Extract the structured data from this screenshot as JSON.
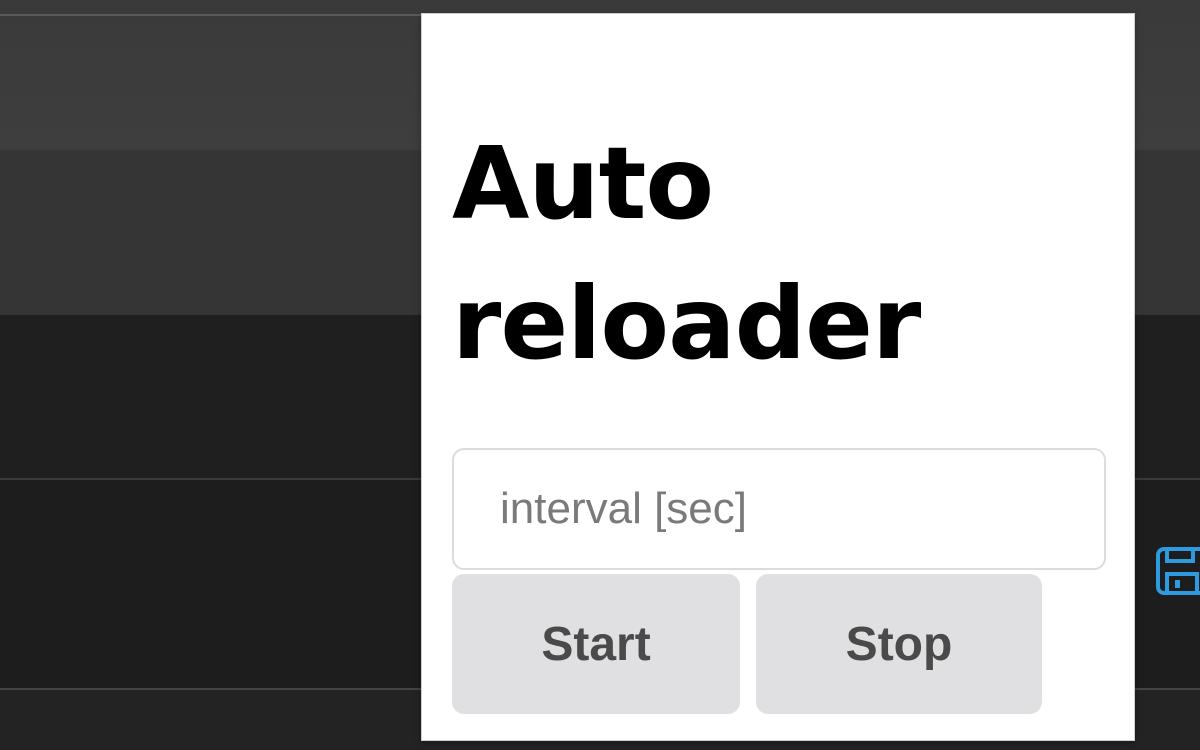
{
  "popup": {
    "title": "Auto reloader",
    "interval_input": {
      "value": "",
      "placeholder": "interval [sec]"
    },
    "start_label": "Start",
    "stop_label": "Stop"
  },
  "background": {
    "icons": [
      "save-icon"
    ],
    "accent_color": "#2e9be0"
  }
}
